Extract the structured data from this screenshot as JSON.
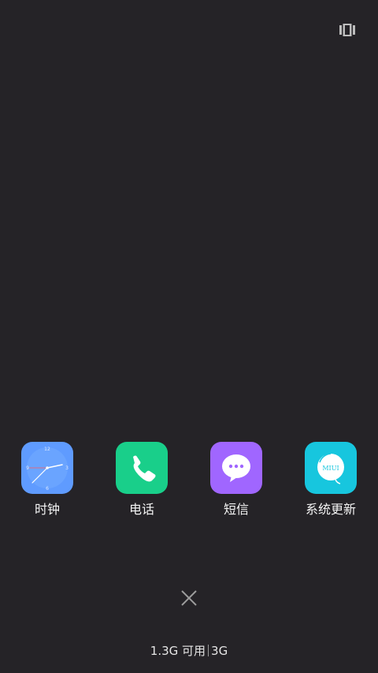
{
  "apps": [
    {
      "label": "时钟",
      "icon": "clock-icon",
      "color": "#5f9bff"
    },
    {
      "label": "电话",
      "icon": "phone-icon",
      "color": "#19cf8a"
    },
    {
      "label": "短信",
      "icon": "message-icon",
      "color": "#a066ff"
    },
    {
      "label": "系统更新",
      "icon": "miui-update-icon",
      "color": "#17c6de",
      "badge_text": "MIUI"
    }
  ],
  "memory": {
    "available": "1.3G 可用",
    "total": "3G"
  },
  "controls": {
    "close_icon": "close-icon",
    "top_right_icon": "multi-window-icon"
  }
}
